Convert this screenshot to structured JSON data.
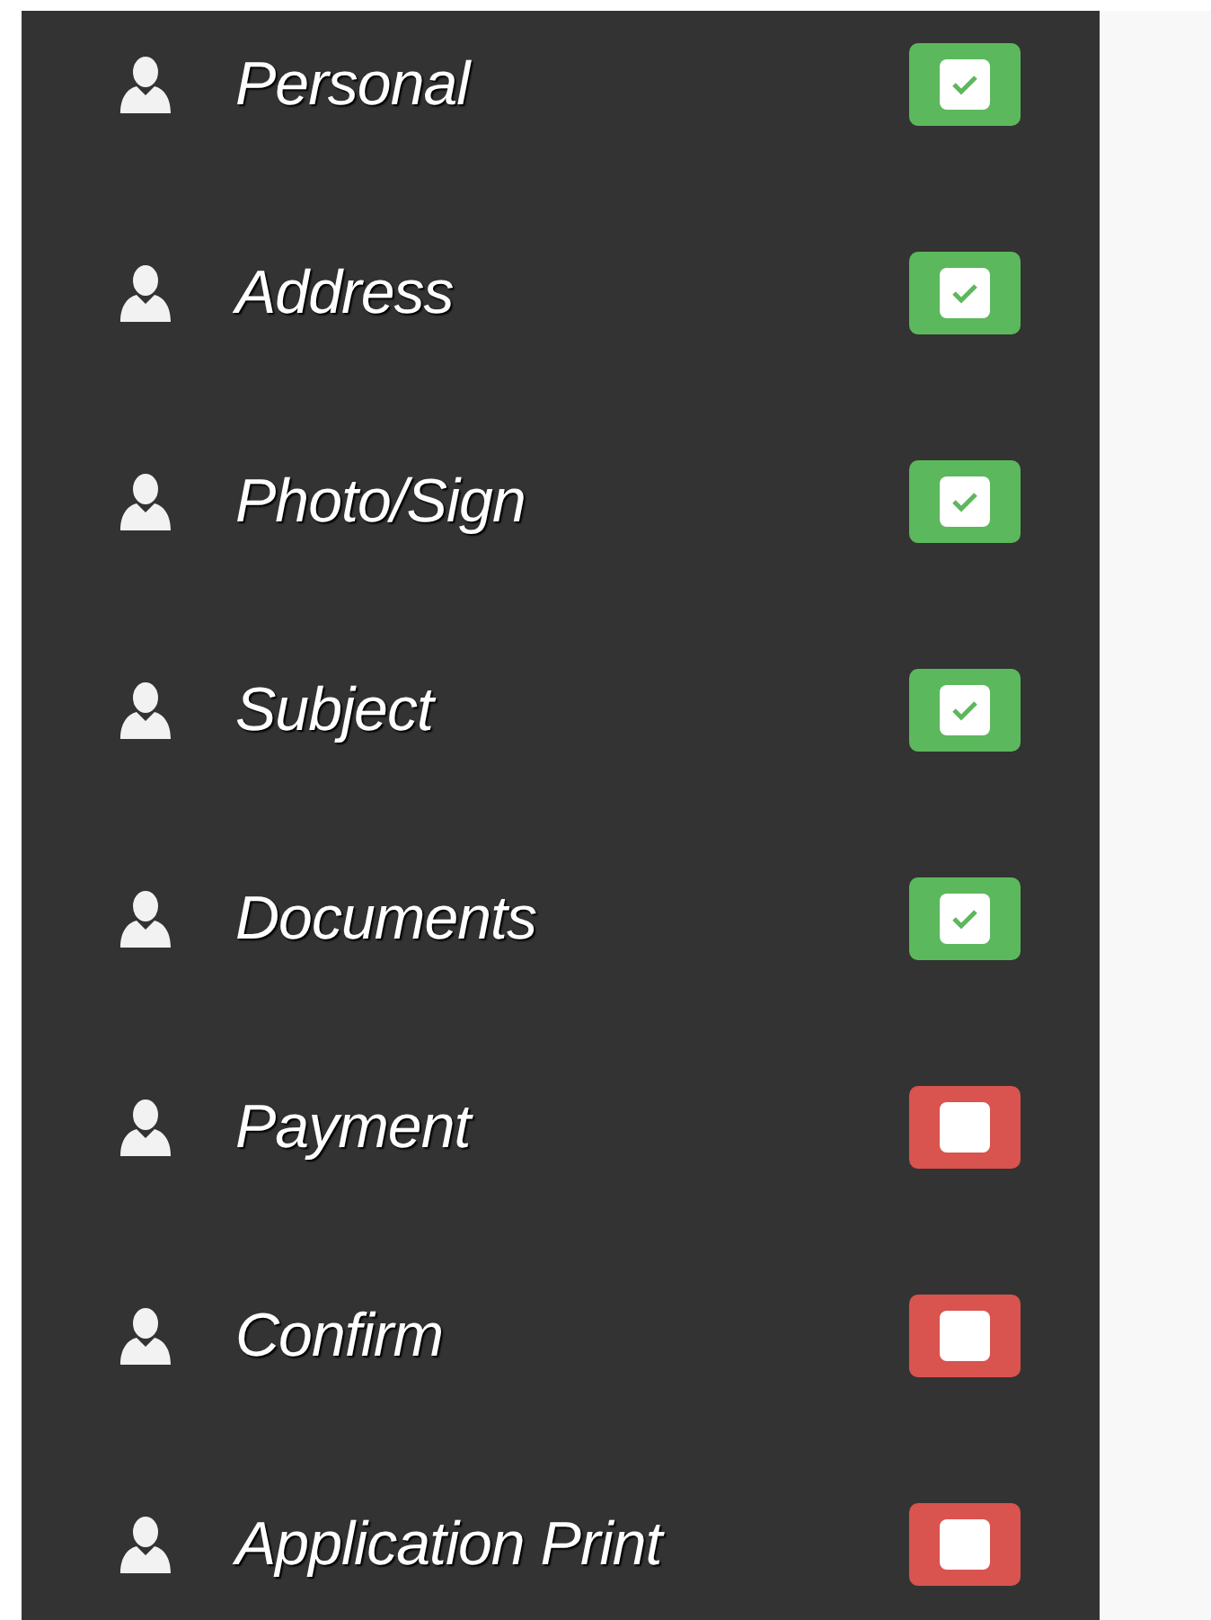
{
  "sidebar": {
    "items": [
      {
        "label": "Personal",
        "checked": true
      },
      {
        "label": "Address",
        "checked": true
      },
      {
        "label": "Photo/Sign",
        "checked": true
      },
      {
        "label": "Subject",
        "checked": true
      },
      {
        "label": "Documents",
        "checked": true
      },
      {
        "label": "Payment",
        "checked": false
      },
      {
        "label": "Confirm",
        "checked": false
      },
      {
        "label": "Application Print",
        "checked": false
      }
    ]
  }
}
